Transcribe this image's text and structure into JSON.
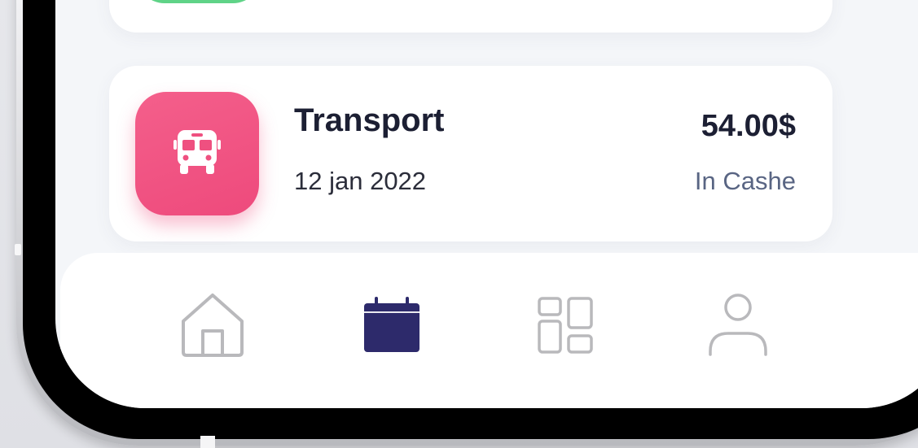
{
  "transaction": {
    "category": "Transport",
    "date": "12 jan 2022",
    "amount": "54.00$",
    "payment_method": "In Cashe",
    "icon": "bus-icon",
    "icon_color": "#F0527F"
  },
  "previous_card": {
    "icon_color": "#5FD387"
  },
  "bottom_nav": {
    "items": [
      {
        "icon": "home-icon",
        "active": false
      },
      {
        "icon": "calendar-icon",
        "active": true
      },
      {
        "icon": "grid-icon",
        "active": false
      },
      {
        "icon": "user-icon",
        "active": false
      }
    ],
    "active_color": "#2D2A6B",
    "inactive_color": "#B9B9BC"
  }
}
